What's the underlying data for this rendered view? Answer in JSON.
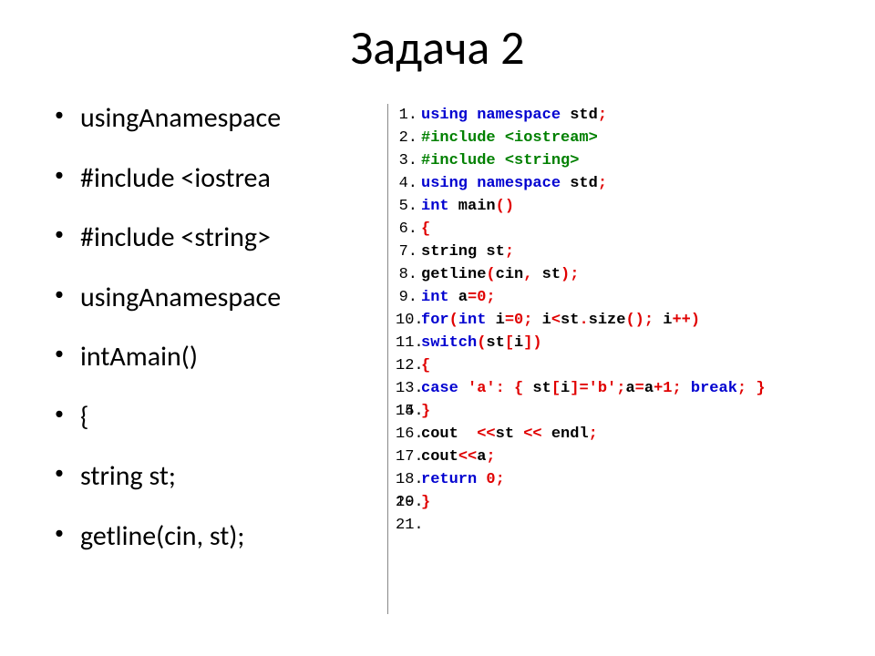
{
  "title": "Задача 2",
  "bullets": [
    "usingАnamespace",
    "#include <iostrea",
    "#include <string>",
    "usingАnamespace",
    "intАmain()",
    "{",
    "string st;",
    "getline(cin, st);"
  ],
  "code": {
    "lines": [
      {
        "n": "1.",
        "tokens": [
          {
            "c": "kw",
            "t": "using namespace"
          },
          {
            "c": "txt",
            "t": " std"
          },
          {
            "c": "op",
            "t": ";"
          }
        ]
      },
      {
        "n": "2.",
        "tokens": [
          {
            "c": "pp",
            "t": "#include <iostream>"
          }
        ]
      },
      {
        "n": "3.",
        "tokens": [
          {
            "c": "pp",
            "t": "#include <string>"
          }
        ]
      },
      {
        "n": "4.",
        "tokens": [
          {
            "c": "kw",
            "t": "using namespace"
          },
          {
            "c": "txt",
            "t": " std"
          },
          {
            "c": "op",
            "t": ";"
          }
        ]
      },
      {
        "n": "5.",
        "tokens": [
          {
            "c": "kw",
            "t": "int"
          },
          {
            "c": "txt",
            "t": " main"
          },
          {
            "c": "op",
            "t": "()"
          }
        ]
      },
      {
        "n": "6.",
        "tokens": [
          {
            "c": "op",
            "t": "{"
          }
        ]
      },
      {
        "n": "7.",
        "tokens": [
          {
            "c": "txt",
            "t": "string st"
          },
          {
            "c": "op",
            "t": ";"
          }
        ]
      },
      {
        "n": "8.",
        "tokens": [
          {
            "c": "txt",
            "t": "getline"
          },
          {
            "c": "op",
            "t": "("
          },
          {
            "c": "txt",
            "t": "cin"
          },
          {
            "c": "op",
            "t": ","
          },
          {
            "c": "txt",
            "t": " st"
          },
          {
            "c": "op",
            "t": ");"
          }
        ]
      },
      {
        "n": "9.",
        "tokens": [
          {
            "c": "kw",
            "t": "int"
          },
          {
            "c": "txt",
            "t": " a"
          },
          {
            "c": "op",
            "t": "="
          },
          {
            "c": "num",
            "t": "0"
          },
          {
            "c": "op",
            "t": ";"
          }
        ]
      },
      {
        "n": "10.",
        "tokens": [
          {
            "c": "kw",
            "t": "for"
          },
          {
            "c": "op",
            "t": "("
          },
          {
            "c": "kw",
            "t": "int"
          },
          {
            "c": "txt",
            "t": " i"
          },
          {
            "c": "op",
            "t": "="
          },
          {
            "c": "num",
            "t": "0"
          },
          {
            "c": "op",
            "t": ";"
          },
          {
            "c": "txt",
            "t": " i"
          },
          {
            "c": "op",
            "t": "<"
          },
          {
            "c": "txt",
            "t": "st"
          },
          {
            "c": "op",
            "t": "."
          },
          {
            "c": "txt",
            "t": "size"
          },
          {
            "c": "op",
            "t": "();"
          },
          {
            "c": "txt",
            "t": " i"
          },
          {
            "c": "op",
            "t": "++)"
          }
        ]
      },
      {
        "n": "11.",
        "tokens": [
          {
            "c": "kw",
            "t": "switch"
          },
          {
            "c": "op",
            "t": "("
          },
          {
            "c": "txt",
            "t": "st"
          },
          {
            "c": "op",
            "t": "["
          },
          {
            "c": "txt",
            "t": "i"
          },
          {
            "c": "op",
            "t": "])"
          }
        ]
      },
      {
        "n": "12.",
        "tokens": [
          {
            "c": "op",
            "t": "{"
          }
        ]
      },
      {
        "n": "13.",
        "tokens": [
          {
            "c": "kw",
            "t": "case"
          },
          {
            "c": "txt",
            "t": " "
          },
          {
            "c": "str",
            "t": "'a'"
          },
          {
            "c": "op",
            "t": ":"
          },
          {
            "c": "txt",
            "t": " "
          },
          {
            "c": "op",
            "t": "{"
          },
          {
            "c": "txt",
            "t": " st"
          },
          {
            "c": "op",
            "t": "["
          },
          {
            "c": "txt",
            "t": "i"
          },
          {
            "c": "op",
            "t": "]="
          },
          {
            "c": "str",
            "t": "'b'"
          },
          {
            "c": "op",
            "t": ";"
          },
          {
            "c": "txt",
            "t": "a"
          },
          {
            "c": "op",
            "t": "="
          },
          {
            "c": "txt",
            "t": "a"
          },
          {
            "c": "op",
            "t": "+"
          },
          {
            "c": "num",
            "t": "1"
          },
          {
            "c": "op",
            "t": ";"
          },
          {
            "c": "txt",
            "t": " "
          },
          {
            "c": "kw",
            "t": "break"
          },
          {
            "c": "op",
            "t": ";"
          },
          {
            "c": "txt",
            "t": " "
          },
          {
            "c": "op",
            "t": "}"
          }
        ]
      },
      {
        "n": "14.",
        "tokens": []
      },
      {
        "n": "15.",
        "tokens": [
          {
            "c": "op",
            "t": "}"
          }
        ]
      },
      {
        "n": "16.",
        "tokens": [
          {
            "c": "txt",
            "t": "cout  "
          },
          {
            "c": "op",
            "t": "<<"
          },
          {
            "c": "txt",
            "t": "st "
          },
          {
            "c": "op",
            "t": "<<"
          },
          {
            "c": "txt",
            "t": " endl"
          },
          {
            "c": "op",
            "t": ";"
          }
        ]
      },
      {
        "n": "17.",
        "tokens": [
          {
            "c": "txt",
            "t": "cout"
          },
          {
            "c": "op",
            "t": "<<"
          },
          {
            "c": "txt",
            "t": "a"
          },
          {
            "c": "op",
            "t": ";"
          }
        ]
      },
      {
        "n": "18.",
        "tokens": [
          {
            "c": "kw",
            "t": "return"
          },
          {
            "c": "txt",
            "t": " "
          },
          {
            "c": "num",
            "t": "0"
          },
          {
            "c": "op",
            "t": ";"
          }
        ]
      },
      {
        "n": "19.",
        "tokens": []
      },
      {
        "n": "20.",
        "tokens": [
          {
            "c": "op",
            "t": "}"
          }
        ]
      },
      {
        "n": "21.",
        "tokens": []
      }
    ]
  }
}
